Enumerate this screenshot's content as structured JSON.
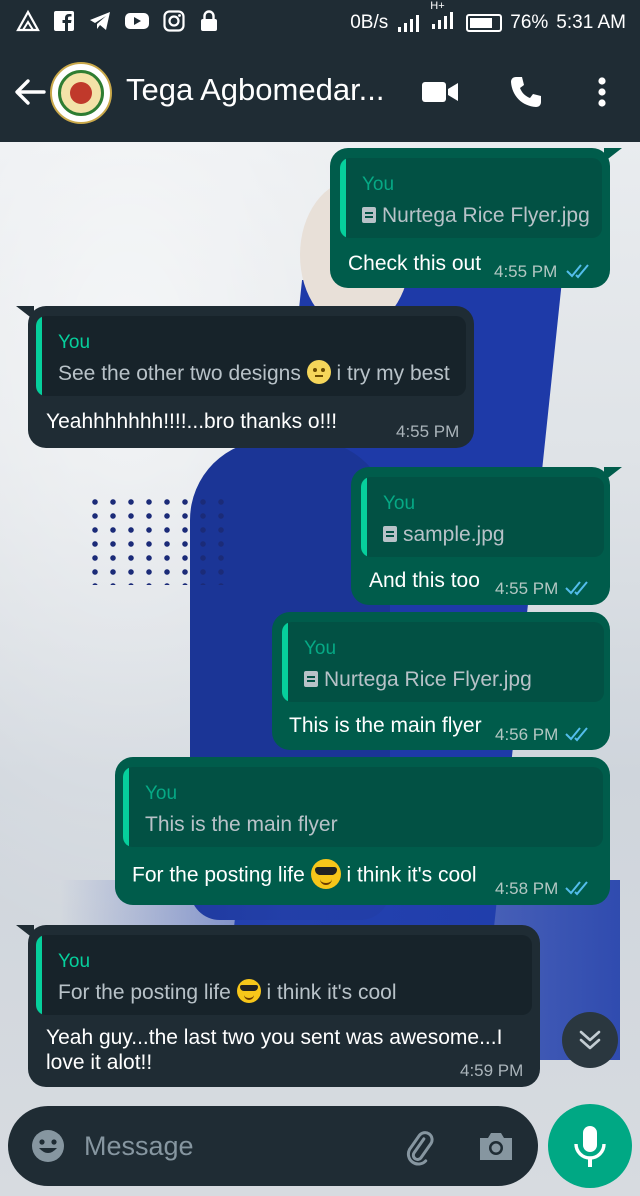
{
  "status_bar": {
    "network_speed": "0B/s",
    "network_type": "H+",
    "battery": "76%",
    "time": "5:31 AM",
    "icons": [
      "warning-triangle-icon",
      "facebook-icon",
      "telegram-icon",
      "youtube-icon",
      "instagram-icon",
      "lock-icon"
    ]
  },
  "header": {
    "contact_name": "Tega Agbomedar...",
    "avatar_alt": "NURTEGA GOLDEN",
    "icons": [
      "back-arrow-icon",
      "video-call-icon",
      "voice-call-icon",
      "more-vert-icon"
    ]
  },
  "messages": [
    {
      "direction": "out",
      "quote_author": "You",
      "quote_text": "Nurtega Rice Flyer.jpg",
      "quote_is_file": true,
      "text": "Check this out",
      "time": "4:55 PM",
      "status": "read"
    },
    {
      "direction": "in",
      "quote_author": "You",
      "quote_text_before": "See the other two designs",
      "quote_text_after": "i try my best",
      "text": "Yeahhhhhhh!!!!...bro thanks o!!!",
      "time": "4:55 PM"
    },
    {
      "direction": "out",
      "quote_author": "You",
      "quote_text": "sample.jpg",
      "quote_is_file": true,
      "text": "And this too",
      "time": "4:55 PM",
      "status": "read"
    },
    {
      "direction": "out",
      "quote_author": "You",
      "quote_text": "Nurtega Rice Flyer.jpg",
      "quote_is_file": true,
      "text": "This is the main flyer",
      "time": "4:56 PM",
      "status": "read"
    },
    {
      "direction": "out",
      "quote_author": "You",
      "quote_text": "This is the main flyer",
      "text_before": "For the posting life",
      "text_after": "i think it's cool",
      "time": "4:58 PM",
      "status": "read"
    },
    {
      "direction": "in",
      "quote_author": "You",
      "quote_text_before": "For the posting life",
      "quote_text_after": "i think it's cool",
      "text": "Yeah guy...the last two you sent was awesome...I love it alot!!",
      "time": "4:59 PM"
    }
  ],
  "composer": {
    "placeholder": "Message"
  },
  "colors": {
    "header_bg": "#1f2c34",
    "outgoing_bubble": "#005c4b",
    "incoming_bubble": "#1f2c34",
    "accent": "#00a884",
    "read_ticks": "#53bdeb"
  }
}
